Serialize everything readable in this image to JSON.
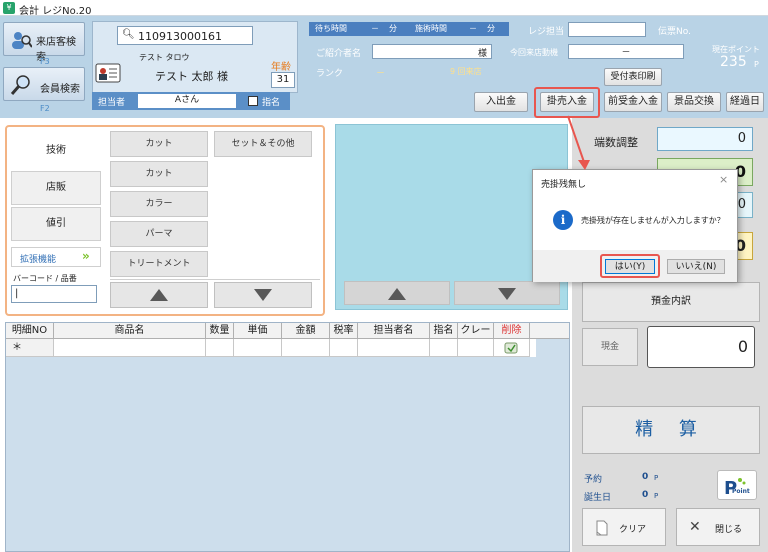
{
  "window": {
    "title": "会計 レジNo.20"
  },
  "top": {
    "visit_search": "来店客検索",
    "visit_key": "F3",
    "member_search": "会員検索",
    "member_key": "F2",
    "customer_id": "110913000161",
    "customer_kana": "テスト タロウ",
    "customer_name": "テスト 太郎 様",
    "age_label": "年齢",
    "age": "31",
    "wait_label": "待ち時間",
    "wait_dash": "－",
    "wait_unit": "分",
    "treat_label": "施術時間",
    "treat_dash": "－",
    "treat_unit": "分",
    "introducer_label": "ご紹介者名",
    "introducer_suffix": "様",
    "rank_label": "ランク",
    "rank_value": "－",
    "visit_count": "9 回来店",
    "register_staff_label": "レジ担当",
    "slip_label": "伝票No.",
    "last_visit_label": "今回来店動機",
    "last_visit_value": "－",
    "point_label": "現在ポイント",
    "point_value": "235",
    "point_unit": "P",
    "receipt_print": "受付表印刷",
    "staff_label": "担当者",
    "staff_value": "Aさん",
    "designate_label": "指名"
  },
  "toolbar": {
    "deposit": "入出金",
    "credit_payment": "掛売入金",
    "advance_payment": "前受金入金",
    "prize_exchange": "景品交換",
    "past_days": "経過日"
  },
  "categories": {
    "tech": "技術",
    "retail": "店販",
    "discount": "値引",
    "extended": "拡張機能",
    "barcode": "バーコード / 品番"
  },
  "menus": [
    "カット",
    "セット＆その他",
    "カット",
    "カラー",
    "パーマ",
    "トリートメント"
  ],
  "grid": {
    "headers": [
      "明細NO",
      "商品名",
      "数量",
      "単価",
      "金額",
      "税率",
      "担当者名",
      "指名",
      "クレー",
      "削除"
    ],
    "new_row_mark": "＊"
  },
  "right": {
    "rounding_label": "端数調整",
    "rounding_value": "0",
    "value2": "0",
    "value3": "0",
    "value4": "0",
    "deposit_detail": "預金内訳",
    "cash_label": "現金",
    "cash_value": "0",
    "settle": "精 算",
    "reserve_label": "予約",
    "reserve_value": "0",
    "reserve_unit": "P",
    "birthday_label": "誕生日",
    "birthday_value": "0",
    "birthday_unit": "P",
    "point_logo": "Point",
    "clear": "クリア",
    "close": "閉じる"
  },
  "dialog": {
    "title": "売掛残無し",
    "message": "売掛残が存在しませんが入力しますか？",
    "yes": "はい(Y)",
    "no": "いいえ(N)"
  },
  "colors": {
    "accent_red": "#e8564f",
    "top_band": "#b9d3e6",
    "blue_bar": "#5b8fc7"
  }
}
